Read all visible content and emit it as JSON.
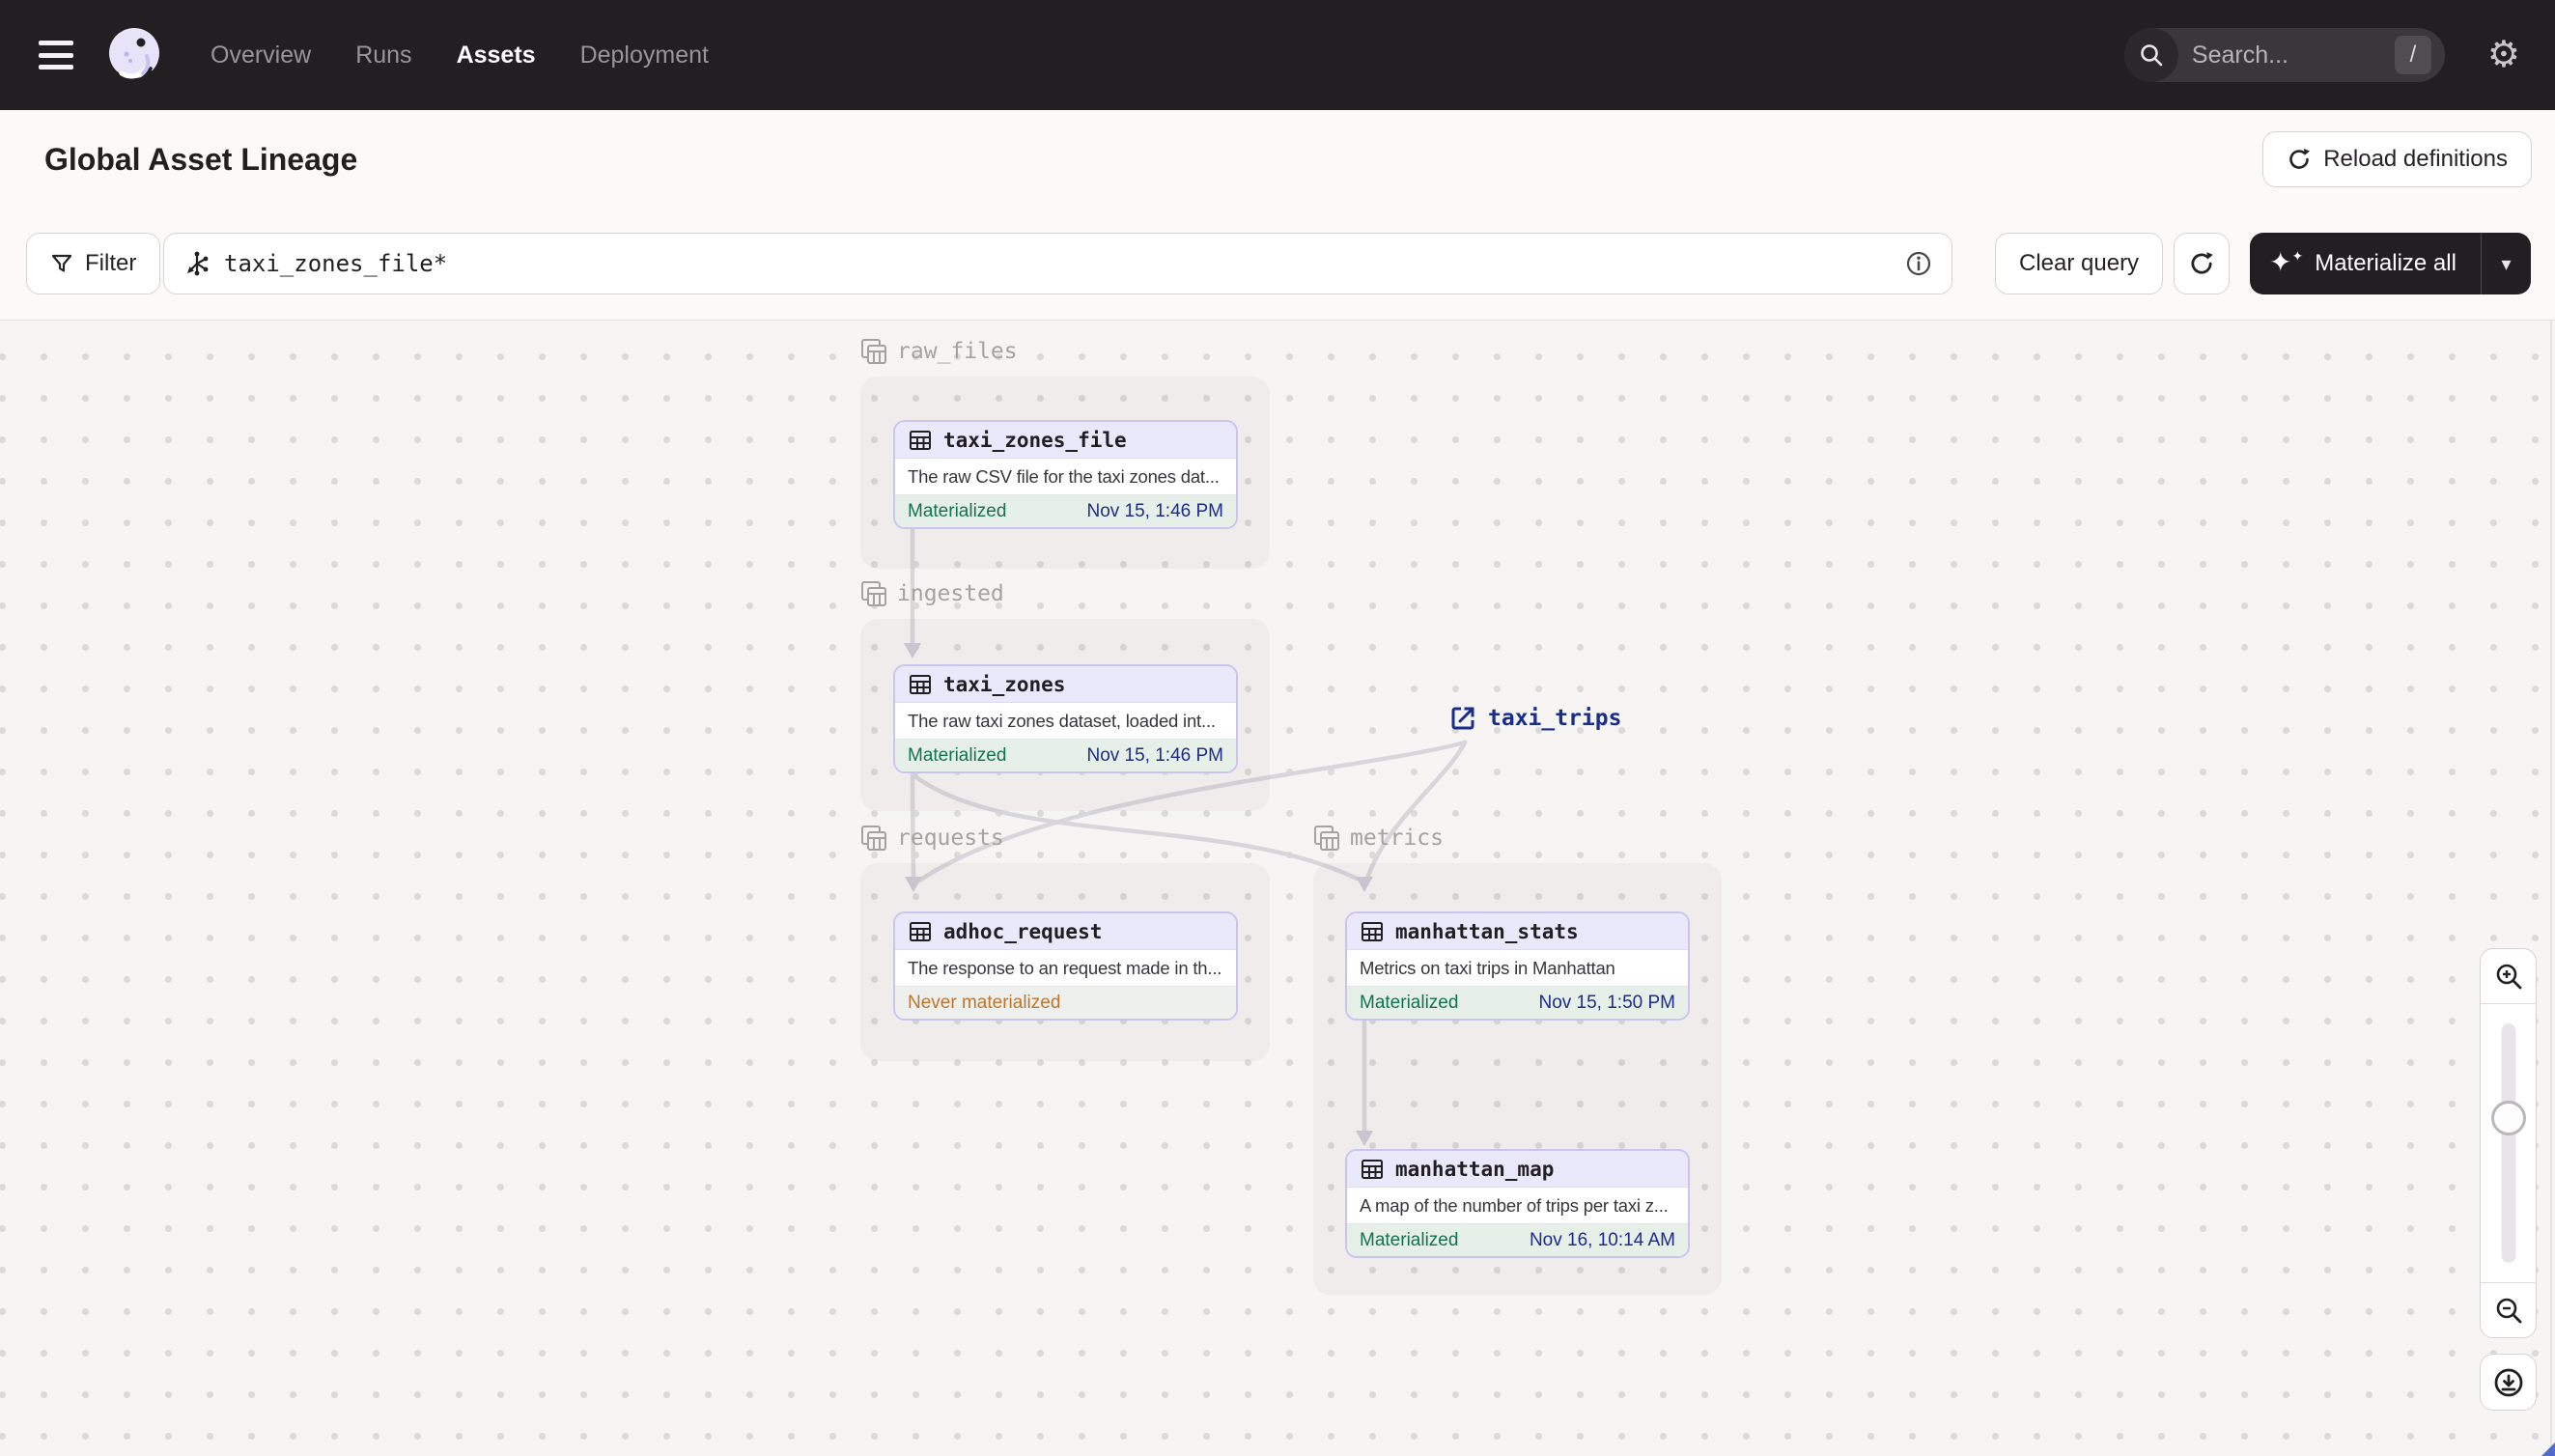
{
  "nav": {
    "links": [
      {
        "label": "Overview"
      },
      {
        "label": "Runs"
      },
      {
        "label": "Assets"
      },
      {
        "label": "Deployment"
      }
    ],
    "active_link": "Assets",
    "search": {
      "placeholder": "Search...",
      "shortcut": "/"
    }
  },
  "header": {
    "title": "Global Asset Lineage",
    "reload_label": "Reload definitions"
  },
  "toolbar": {
    "filter_label": "Filter",
    "query_value": "taxi_zones_file*",
    "clear_label": "Clear query",
    "materialize_label": "Materialize all"
  },
  "graph": {
    "groups": {
      "raw_files": "raw_files",
      "ingested": "ingested",
      "requests": "requests",
      "metrics": "metrics"
    },
    "nodes": {
      "taxi_zones_file": {
        "name": "taxi_zones_file",
        "description": "The raw CSV file for the taxi zones dat...",
        "status": "Materialized",
        "timestamp": "Nov 15, 1:46 PM"
      },
      "taxi_zones": {
        "name": "taxi_zones",
        "description": "The raw taxi zones dataset, loaded int...",
        "status": "Materialized",
        "timestamp": "Nov 15, 1:46 PM"
      },
      "adhoc_request": {
        "name": "adhoc_request",
        "description": "The response to an request made in th...",
        "status": "Never materialized",
        "timestamp": ""
      },
      "manhattan_stats": {
        "name": "manhattan_stats",
        "description": "Metrics on taxi trips in Manhattan",
        "status": "Materialized",
        "timestamp": "Nov 15, 1:50 PM"
      },
      "manhattan_map": {
        "name": "manhattan_map",
        "description": "A map of the number of trips per taxi z...",
        "status": "Materialized",
        "timestamp": "Nov 16, 10:14 AM"
      }
    },
    "external": {
      "name": "taxi_trips"
    }
  },
  "colors": {
    "navbar_bg": "#211f22",
    "node_border": "#c9c5f0",
    "node_header_bg": "#eae8fb",
    "materialized_green": "#12734e",
    "never_materialized_orange": "#bd752f",
    "timestamp_navy": "#1c2c8c",
    "edge_gray": "#d9d6db"
  }
}
